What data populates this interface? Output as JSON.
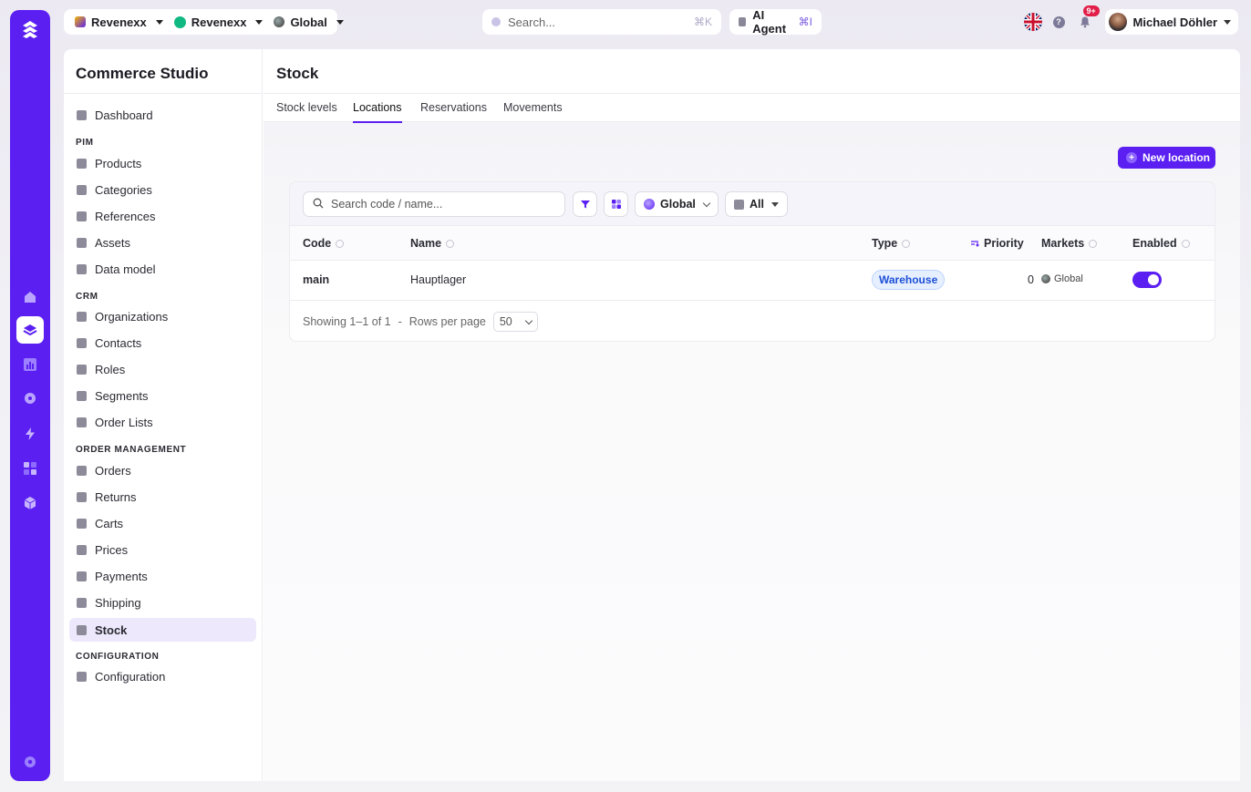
{
  "topbar": {
    "org1": "Revenexx",
    "org2": "Revenexx",
    "scope": "Global",
    "search_placeholder": "Search...",
    "search_shortcut": "⌘K",
    "agent_label": "AI Agent",
    "agent_shortcut": "⌘I",
    "help": "?",
    "notifications_badge": "9+",
    "user_name": "Michael Döhler"
  },
  "sidebar": {
    "title": "Commerce Studio",
    "items": [
      {
        "label": "Dashboard"
      },
      {
        "section": "PIM"
      },
      {
        "label": "Products"
      },
      {
        "label": "Categories"
      },
      {
        "label": "References"
      },
      {
        "label": "Assets"
      },
      {
        "label": "Data model"
      },
      {
        "section": "CRM"
      },
      {
        "label": "Organizations"
      },
      {
        "label": "Contacts"
      },
      {
        "label": "Roles"
      },
      {
        "label": "Segments"
      },
      {
        "label": "Order Lists"
      },
      {
        "section": "ORDER MANAGEMENT"
      },
      {
        "label": "Orders"
      },
      {
        "label": "Returns"
      },
      {
        "label": "Carts"
      },
      {
        "label": "Prices"
      },
      {
        "label": "Payments"
      },
      {
        "label": "Shipping"
      },
      {
        "label": "Stock",
        "active": true
      },
      {
        "section": "CONFIGURATION"
      },
      {
        "label": "Configuration"
      }
    ]
  },
  "page": {
    "title": "Stock",
    "tabs": [
      {
        "label": "Stock levels"
      },
      {
        "label": "Locations",
        "active": true
      },
      {
        "label": "Reservations"
      },
      {
        "label": "Movements"
      }
    ],
    "new_button": "New location",
    "new_icon": "+"
  },
  "table": {
    "search_placeholder": "Search code / name...",
    "scope_filter": "Global",
    "type_filter": "All",
    "columns": [
      "Code",
      "Name",
      "Type",
      "Priority",
      "Markets",
      "Enabled"
    ],
    "rows": [
      {
        "code": "main",
        "name": "Hauptlager",
        "type": "Warehouse",
        "priority": "0",
        "market": "Global",
        "enabled": true
      }
    ],
    "footer": {
      "showing": "Showing 1–1 of 1",
      "sep": "-",
      "rows_per_page_label": "Rows per page",
      "rows_per_page": "50"
    }
  },
  "colors": {
    "brand": "#5b1ff2",
    "success": "#10b981",
    "badge": "#e11d48",
    "type_badge_bg": "#e6efff"
  }
}
